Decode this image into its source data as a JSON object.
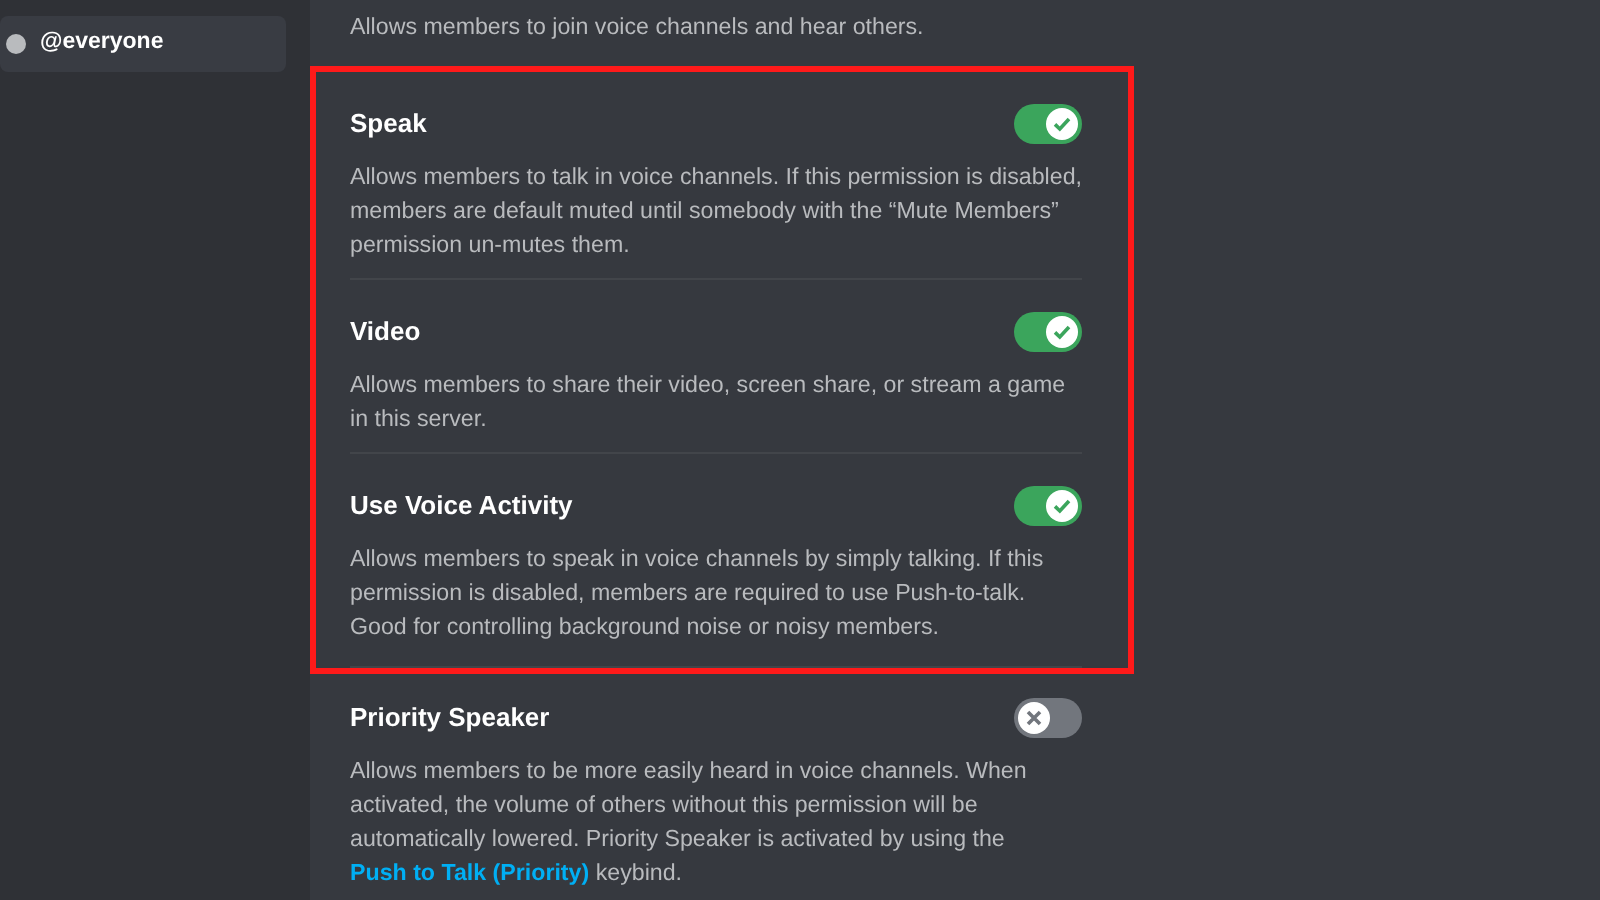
{
  "sidebar": {
    "roles": [
      {
        "name": "@everyone",
        "selected": true
      }
    ]
  },
  "intro_text": "Allows members to join voice channels and hear others.",
  "permissions": [
    {
      "title": "Speak",
      "on": true,
      "highlighted": true,
      "description": "Allows members to talk in voice channels. If this permission is disabled, members are default muted until somebody with the “Mute Members” permission un-mutes them."
    },
    {
      "title": "Video",
      "on": true,
      "highlighted": true,
      "description": "Allows members to share their video, screen share, or stream a game in this server."
    },
    {
      "title": "Use Voice Activity",
      "on": true,
      "highlighted": true,
      "description": "Allows members to speak in voice channels by simply talking. If this permission is disabled, members are required to use Push-to-talk. Good for controlling background noise or noisy members."
    },
    {
      "title": "Priority Speaker",
      "on": false,
      "highlighted": false,
      "description": "Allows members to be more easily heard in voice channels. When activated, the volume of others without this permission will be automatically lowered. Priority Speaker is activated by using the",
      "link": "Push to Talk (Priority)",
      "after": "keybind."
    }
  ]
}
